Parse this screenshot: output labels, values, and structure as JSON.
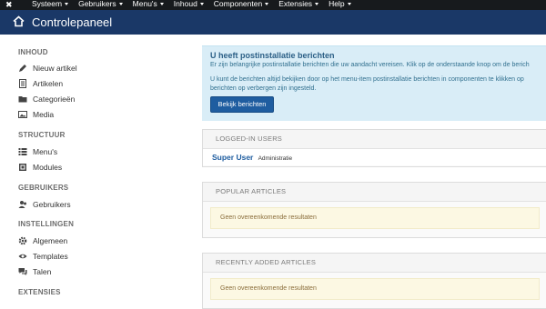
{
  "topbar": {
    "logo_icon": "joomla-logo-icon",
    "menus": [
      "Systeem",
      "Gebruikers",
      "Menu's",
      "Inhoud",
      "Componenten",
      "Extensies",
      "Help"
    ]
  },
  "header": {
    "home_icon": "home-icon",
    "title": "Controlepaneel"
  },
  "sidebar": {
    "sections": [
      {
        "label": "INHOUD",
        "items": [
          {
            "label": "Nieuw artikel",
            "icon": "pencil-icon"
          },
          {
            "label": "Artikelen",
            "icon": "article-icon"
          },
          {
            "label": "Categorieën",
            "icon": "folder-icon"
          },
          {
            "label": "Media",
            "icon": "image-icon"
          }
        ]
      },
      {
        "label": "STRUCTUUR",
        "items": [
          {
            "label": "Menu's",
            "icon": "list-icon"
          },
          {
            "label": "Modules",
            "icon": "cube-icon"
          }
        ]
      },
      {
        "label": "GEBRUIKERS",
        "items": [
          {
            "label": "Gebruikers",
            "icon": "users-icon"
          }
        ]
      },
      {
        "label": "INSTELLINGEN",
        "items": [
          {
            "label": "Algemeen",
            "icon": "gear-icon"
          },
          {
            "label": "Templates",
            "icon": "eye-icon"
          },
          {
            "label": "Talen",
            "icon": "comments-icon"
          }
        ]
      },
      {
        "label": "EXTENSIES",
        "items": []
      }
    ]
  },
  "alert": {
    "title": "U heeft postinstallatie berichten",
    "line1": "Er zijn belangrijke postinstallatie berichten die uw aandacht vereisen. Klik op de onderstaande knop om de berich",
    "line2": "U kunt de berichten altijd bekijken door op het menu-item postinstallatie berichten in componenten te klikken op",
    "line3": "berichten op verbergen zijn ingesteld.",
    "button": "Bekijk berichten"
  },
  "panels": {
    "logged_in": {
      "title": "LOGGED-IN USERS",
      "user": "Super User",
      "role": "Administratie"
    },
    "popular": {
      "title": "POPULAR ARTICLES",
      "message": "Geen overeenkomende resultaten"
    },
    "recent": {
      "title": "RECENTLY ADDED ARTICLES",
      "message": "Geen overeenkomende resultaten"
    }
  },
  "colors": {
    "topbar": "#171a1d",
    "header": "#1a3867",
    "alert_bg": "#d9edf7",
    "button": "#1f5da0",
    "warning_bg": "#fcf8e3"
  }
}
